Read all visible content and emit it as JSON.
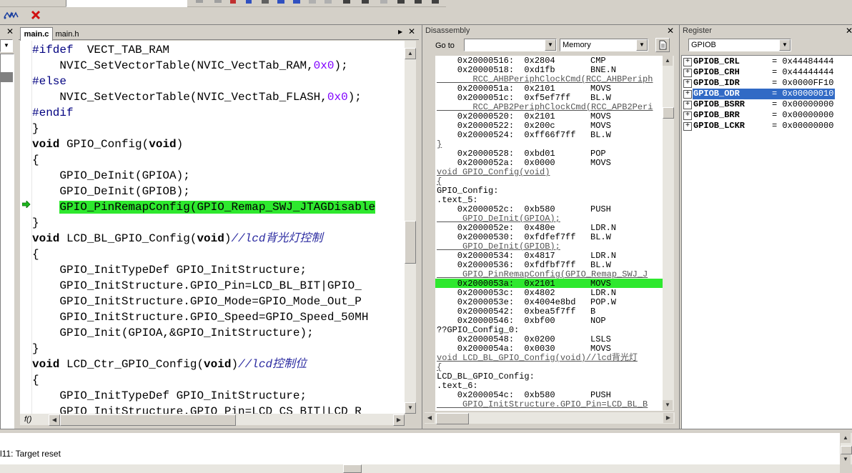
{
  "editor": {
    "tabs": [
      {
        "label": "main.c",
        "active": true
      },
      {
        "label": "main.h",
        "active": false
      }
    ],
    "lines": [
      {
        "parts": [
          {
            "t": "#ifdef",
            "c": "kw-dir"
          },
          {
            "t": "  VECT_TAB_RAM",
            "c": ""
          }
        ]
      },
      {
        "parts": [
          {
            "t": "    NVIC_SetVectorTable(NVIC_VectTab_RAM,",
            "c": ""
          },
          {
            "t": "0x0",
            "c": "num"
          },
          {
            "t": ");",
            "c": ""
          }
        ]
      },
      {
        "parts": [
          {
            "t": "#else",
            "c": "kw-dir"
          }
        ]
      },
      {
        "parts": [
          {
            "t": "    NVIC_SetVectorTable(NVIC_VectTab_FLASH,",
            "c": ""
          },
          {
            "t": "0x0",
            "c": "num"
          },
          {
            "t": ");",
            "c": ""
          }
        ]
      },
      {
        "parts": [
          {
            "t": "#endif",
            "c": "kw-dir"
          }
        ]
      },
      {
        "parts": [
          {
            "t": "}",
            "c": ""
          }
        ]
      },
      {
        "parts": [
          {
            "t": "void",
            "c": "kw"
          },
          {
            "t": " GPIO_Config(",
            "c": ""
          },
          {
            "t": "void",
            "c": "kw"
          },
          {
            "t": ")",
            "c": ""
          }
        ]
      },
      {
        "parts": [
          {
            "t": "{",
            "c": ""
          }
        ]
      },
      {
        "parts": [
          {
            "t": "    GPIO_DeInit(GPIOA);",
            "c": ""
          }
        ]
      },
      {
        "parts": [
          {
            "t": "    GPIO_DeInit(GPIOB);",
            "c": ""
          }
        ]
      },
      {
        "parts": [
          {
            "t": "    ",
            "c": ""
          },
          {
            "t": "GPIO_PinRemapConfig(GPIO_Remap_SWJ_JTAGDisable",
            "c": "hl"
          }
        ],
        "current": true
      },
      {
        "parts": [
          {
            "t": "}",
            "c": ""
          }
        ]
      },
      {
        "parts": [
          {
            "t": "void",
            "c": "kw"
          },
          {
            "t": " LCD_BL_GPIO_Config(",
            "c": ""
          },
          {
            "t": "void",
            "c": "kw"
          },
          {
            "t": ")",
            "c": ""
          },
          {
            "t": "//lcd背光灯控制",
            "c": "cmt"
          }
        ]
      },
      {
        "parts": [
          {
            "t": "{",
            "c": ""
          }
        ]
      },
      {
        "parts": [
          {
            "t": "    GPIO_InitTypeDef GPIO_InitStructure;",
            "c": ""
          }
        ]
      },
      {
        "parts": [
          {
            "t": "    GPIO_InitStructure.GPIO_Pin=LCD_BL_BIT|GPIO_",
            "c": ""
          }
        ]
      },
      {
        "parts": [
          {
            "t": "    GPIO_InitStructure.GPIO_Mode=GPIO_Mode_Out_P",
            "c": ""
          }
        ]
      },
      {
        "parts": [
          {
            "t": "    GPIO_InitStructure.GPIO_Speed=GPIO_Speed_50MH",
            "c": ""
          }
        ]
      },
      {
        "parts": [
          {
            "t": "    GPIO_Init(GPIOA,&GPIO_InitStructure);",
            "c": ""
          }
        ]
      },
      {
        "parts": [
          {
            "t": "}",
            "c": ""
          }
        ]
      },
      {
        "parts": [
          {
            "t": "void",
            "c": "kw"
          },
          {
            "t": " LCD_Ctr_GPIO_Config(",
            "c": ""
          },
          {
            "t": "void",
            "c": "kw"
          },
          {
            "t": ")",
            "c": ""
          },
          {
            "t": "//lcd控制位",
            "c": "cmt"
          }
        ]
      },
      {
        "parts": [
          {
            "t": "{",
            "c": ""
          }
        ]
      },
      {
        "parts": [
          {
            "t": "    GPIO_InitTypeDef GPIO_InitStructure;",
            "c": ""
          }
        ]
      },
      {
        "parts": [
          {
            "t": "    GPIO_InitStructure.GPIO_Pin=LCD_CS_BIT|LCD_R",
            "c": ""
          }
        ]
      }
    ],
    "func_button": "f()",
    "highlight_color": "#2ee82e"
  },
  "disassembly": {
    "title": "Disassembly",
    "goto_label": "Go to",
    "memory_label": "Memory",
    "lines": [
      {
        "a": "    0x20000516:  0x2804",
        "m": "CMP",
        "k": "i"
      },
      {
        "a": "    0x20000518:  0xd1fb",
        "m": "BNE.N",
        "k": "i"
      },
      {
        "a": "       RCC_AHBPeriphClockCmd(RCC_AHBPeriph",
        "m": "",
        "k": "s"
      },
      {
        "a": "    0x2000051a:  0x2101",
        "m": "MOVS",
        "k": "i"
      },
      {
        "a": "    0x2000051c:  0xf5ef7ff",
        "m": "BL.W",
        "k": "i"
      },
      {
        "a": "       RCC_APB2PeriphClockCmd(RCC_APB2Peri",
        "m": "",
        "k": "s"
      },
      {
        "a": "    0x20000520:  0x2101",
        "m": "MOVS",
        "k": "i"
      },
      {
        "a": "    0x20000522:  0x200c",
        "m": "MOVS",
        "k": "i"
      },
      {
        "a": "    0x20000524:  0xff66f7ff",
        "m": "BL.W",
        "k": "i"
      },
      {
        "a": "}",
        "m": "",
        "k": "s"
      },
      {
        "a": "    0x20000528:  0xbd01",
        "m": "POP",
        "k": "i"
      },
      {
        "a": "    0x2000052a:  0x0000",
        "m": "MOVS",
        "k": "i"
      },
      {
        "a": "void GPIO_Config(void)",
        "m": "",
        "k": "s"
      },
      {
        "a": "{",
        "m": "",
        "k": "s"
      },
      {
        "a": "GPIO_Config:",
        "m": "",
        "k": "l"
      },
      {
        "a": ".text_5:",
        "m": "",
        "k": "l"
      },
      {
        "a": "    0x2000052c:  0xb580",
        "m": "PUSH",
        "k": "i"
      },
      {
        "a": "     GPIO_DeInit(GPIOA);",
        "m": "",
        "k": "s"
      },
      {
        "a": "    0x2000052e:  0x480e",
        "m": "LDR.N",
        "k": "i"
      },
      {
        "a": "    0x20000530:  0xfdfef7ff",
        "m": "BL.W",
        "k": "i"
      },
      {
        "a": "     GPIO_DeInit(GPIOB);",
        "m": "",
        "k": "s"
      },
      {
        "a": "    0x20000534:  0x4817",
        "m": "LDR.N",
        "k": "i"
      },
      {
        "a": "    0x20000536:  0xfdfbf7ff",
        "m": "BL.W",
        "k": "i"
      },
      {
        "a": "     GPIO_PinRemapConfig(GPIO_Remap_SWJ_J",
        "m": "",
        "k": "s"
      },
      {
        "a": "    0x2000053a:  0x2101",
        "m": "MOVS",
        "k": "h"
      },
      {
        "a": "    0x2000053c:  0x4802",
        "m": "LDR.N",
        "k": "i"
      },
      {
        "a": "    0x2000053e:  0x4004e8bd",
        "m": "POP.W",
        "k": "i"
      },
      {
        "a": "    0x20000542:  0xbea5f7ff",
        "m": "B",
        "k": "i"
      },
      {
        "a": "    0x20000546:  0xbf00",
        "m": "NOP",
        "k": "i"
      },
      {
        "a": "??GPIO_Config_0:",
        "m": "",
        "k": "l"
      },
      {
        "a": "    0x20000548:  0x0200",
        "m": "LSLS",
        "k": "i"
      },
      {
        "a": "    0x2000054a:  0x0030",
        "m": "MOVS",
        "k": "i"
      },
      {
        "a": "void LCD_BL_GPIO_Config(void)//lcd背光灯",
        "m": "",
        "k": "s"
      },
      {
        "a": "{",
        "m": "",
        "k": "s"
      },
      {
        "a": "LCD_BL_GPIO_Config:",
        "m": "",
        "k": "l"
      },
      {
        "a": ".text_6:",
        "m": "",
        "k": "l"
      },
      {
        "a": "    0x2000054c:  0xb580",
        "m": "PUSH",
        "k": "i"
      },
      {
        "a": "     GPIO_InitStructure.GPIO_Pin=LCD_BL_B",
        "m": "",
        "k": "s"
      }
    ]
  },
  "register": {
    "title": "Register",
    "selected_group": "GPIOB",
    "rows": [
      {
        "name": "GPIOB_CRL",
        "value": "= 0x44484444",
        "selected": false
      },
      {
        "name": "GPIOB_CRH",
        "value": "= 0x44444444",
        "selected": false
      },
      {
        "name": "GPIOB_IDR",
        "value": "= 0x0000FF10",
        "selected": false
      },
      {
        "name": "GPIOB_ODR",
        "value": "= 0x00000010",
        "selected": true
      },
      {
        "name": "GPIOB_BSRR",
        "value": "= 0x00000000",
        "selected": false
      },
      {
        "name": "GPIOB_BRR",
        "value": "= 0x00000000",
        "selected": false
      },
      {
        "name": "GPIOB_LCKR",
        "value": "= 0x00000000",
        "selected": false
      }
    ]
  },
  "output": {
    "message": "l11: Target reset"
  }
}
